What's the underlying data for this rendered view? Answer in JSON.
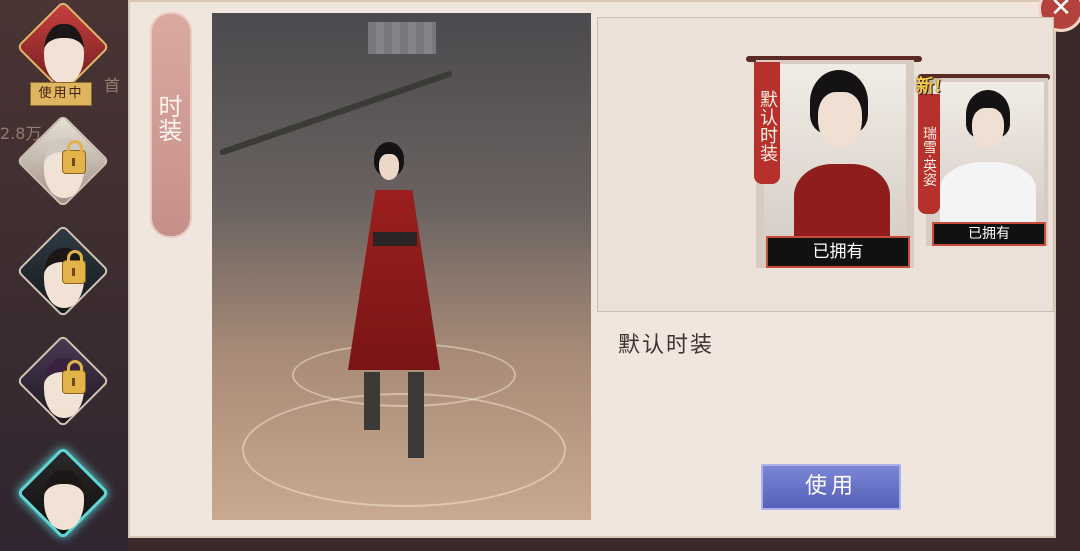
{
  "left_column": {
    "side_texts": [
      "首",
      "2.8万"
    ],
    "characters": [
      {
        "name": "char-slot-1",
        "state": "in-use",
        "badge": "使用中"
      },
      {
        "name": "char-slot-2",
        "state": "locked"
      },
      {
        "name": "char-slot-3",
        "state": "locked"
      },
      {
        "name": "char-slot-4",
        "state": "locked"
      },
      {
        "name": "char-slot-5",
        "state": "selected"
      }
    ]
  },
  "tab": {
    "label": "时装"
  },
  "close_button": {
    "glyph": "✕"
  },
  "costumes": [
    {
      "ribbon": "默认时装",
      "tag": "已拥有",
      "selected": true
    },
    {
      "ribbon": "瑞雪·英姿",
      "tag": "已拥有",
      "new_badge": "新!"
    }
  ],
  "selected_costume_name": "默认时装",
  "use_button": {
    "label": "使用"
  },
  "colors": {
    "accent_red": "#b6302c",
    "use_button": "#5560b8",
    "selection_glow": "#5fd6d6",
    "lock_gold": "#e2b34a"
  }
}
